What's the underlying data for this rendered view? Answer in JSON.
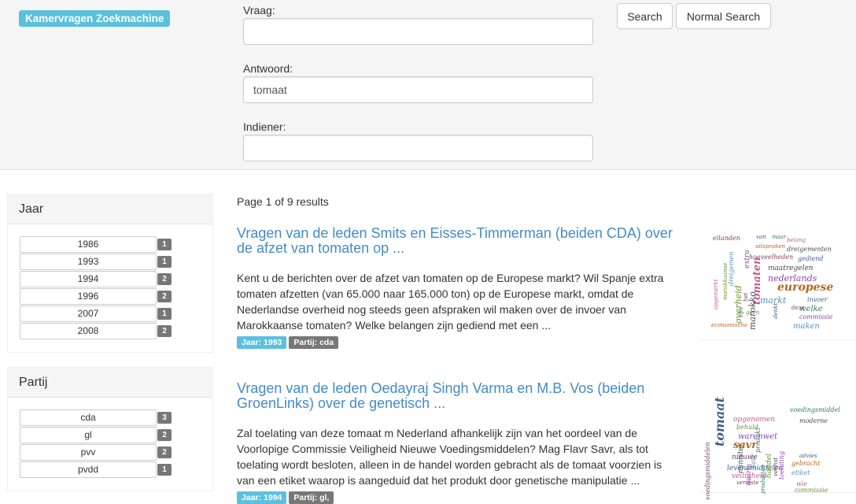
{
  "brand": "Kamervragen Zoekmachine",
  "search": {
    "vraag_label": "Vraag:",
    "vraag_value": "",
    "antwoord_label": "Antwoord:",
    "antwoord_value": "tomaat",
    "indiener_label": "Indiener:",
    "indiener_value": "",
    "search_button": "Search",
    "normal_search_button": "Normal Search"
  },
  "facets": {
    "jaar": {
      "title": "Jaar",
      "items": [
        {
          "label": "1986",
          "count": "1"
        },
        {
          "label": "1993",
          "count": "1"
        },
        {
          "label": "1994",
          "count": "2"
        },
        {
          "label": "1996",
          "count": "2"
        },
        {
          "label": "2007",
          "count": "1"
        },
        {
          "label": "2008",
          "count": "2"
        }
      ]
    },
    "partij": {
      "title": "Partij",
      "items": [
        {
          "label": "cda",
          "count": "3"
        },
        {
          "label": "gl",
          "count": "2"
        },
        {
          "label": "pvv",
          "count": "2"
        },
        {
          "label": "pvdd",
          "count": "1"
        }
      ]
    }
  },
  "results_summary": "Page 1 of 9 results",
  "results": [
    {
      "title": "Vragen van de leden Smits en Eisses-Timmerman (beiden CDA) over de afzet van tomaten op ...",
      "snippet": "Kent u de berichten over de afzet van tomaten op de Europese markt? Wil Spanje extra tomaten afzetten (van 65.000 naar 165.000 ton) op de Europese markt, omdat de Nederlandse overheid nog steeds geen afspraken wil maken over de invoer van Marokkaanse tomaten? Welke belangen zijn gediend met een ...",
      "year_tag": "Jaar: 1993",
      "party_tag": "Partij: cda",
      "cloud_words": [
        "eilanden",
        "van",
        "maar",
        "belang",
        "dreigementen",
        "marokkaanse",
        "extra",
        "uitspraken",
        "dreigemen",
        "hoeveelheden",
        "gediend",
        "zijn",
        "tomaten",
        "maatregelen",
        "overheid",
        "nederlands",
        "europese",
        "markt",
        "het",
        "invoer",
        "welke",
        "opgemerkt",
        "marokko",
        "geen",
        "commissie",
        "economische",
        "maken",
        "deze",
        "denkt"
      ]
    },
    {
      "title": "Vragen van de leden Oedayraj Singh Varma en M.B. Vos (beiden GroenLinks) over de genetisch ...",
      "snippet": "Zal toelating van deze tomaat m Nederland afhankelijk zijn van het oordeel van de Voorlopige Commissie Veiligheid Nieuwe Voedingsmiddelen? Mag Flavr Savr, als tot toelating wordt besloten, alleen in de handel worden gebracht als de tomaat voorzien is van een etiket waarop is aangeduid dat het produkt door genetische manipulatie ...",
      "year_tag": "Jaar: 1994",
      "party_tag": "Partij: gl,",
      "cloud_words": [
        "voedingsmiddelen",
        "tomaat",
        "voedingsmiddel",
        "opgenomen",
        "moderne",
        "behuld",
        "warenwet",
        "savr",
        "flavr",
        "nieuwe",
        "levensmiddelen",
        "produkt",
        "veiligheid",
        "minister",
        "handel",
        "waarin",
        "gebracht",
        "etiket",
        "vereiste",
        "advies",
        "produkten",
        "wie",
        "vereist",
        "commissie",
        "toelating"
      ]
    }
  ],
  "colors": {
    "accent": "#5bc0de",
    "link": "#428bca",
    "badge": "#777777"
  }
}
